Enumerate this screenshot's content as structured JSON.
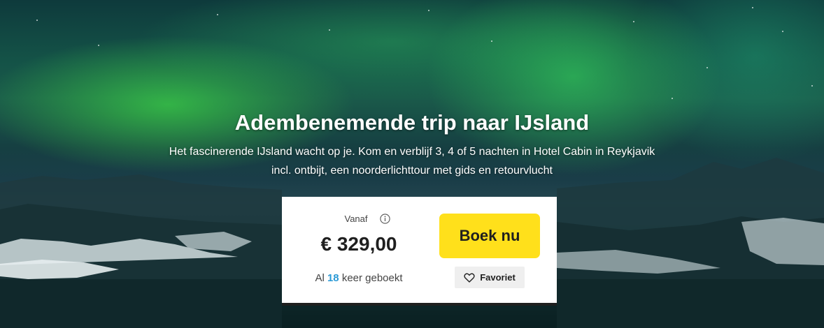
{
  "hero": {
    "title": "Adembenemende trip naar IJsland",
    "subtitle": "Het fascinerende IJsland wacht op je. Kom en verblijf 3, 4 of 5 nachten in Hotel Cabin in Reykjavik incl. ontbijt, een noorderlichttour met gids en retourvlucht",
    "background_icon": "northern-lights-image"
  },
  "offer": {
    "from_label": "Vanaf",
    "info_icon": "info-icon",
    "price": "€ 329,00",
    "booked_prefix": "Al",
    "booked_count": "18",
    "booked_suffix": "keer geboekt",
    "book_label": "Boek nu",
    "favorite_label": "Favoriet",
    "favorite_icon": "heart-icon"
  },
  "colors": {
    "book_button": "#ffe01b",
    "booked_count": "#2b9ad6",
    "favorite_button": "#efefef",
    "card_border": "#1f1f1f"
  }
}
